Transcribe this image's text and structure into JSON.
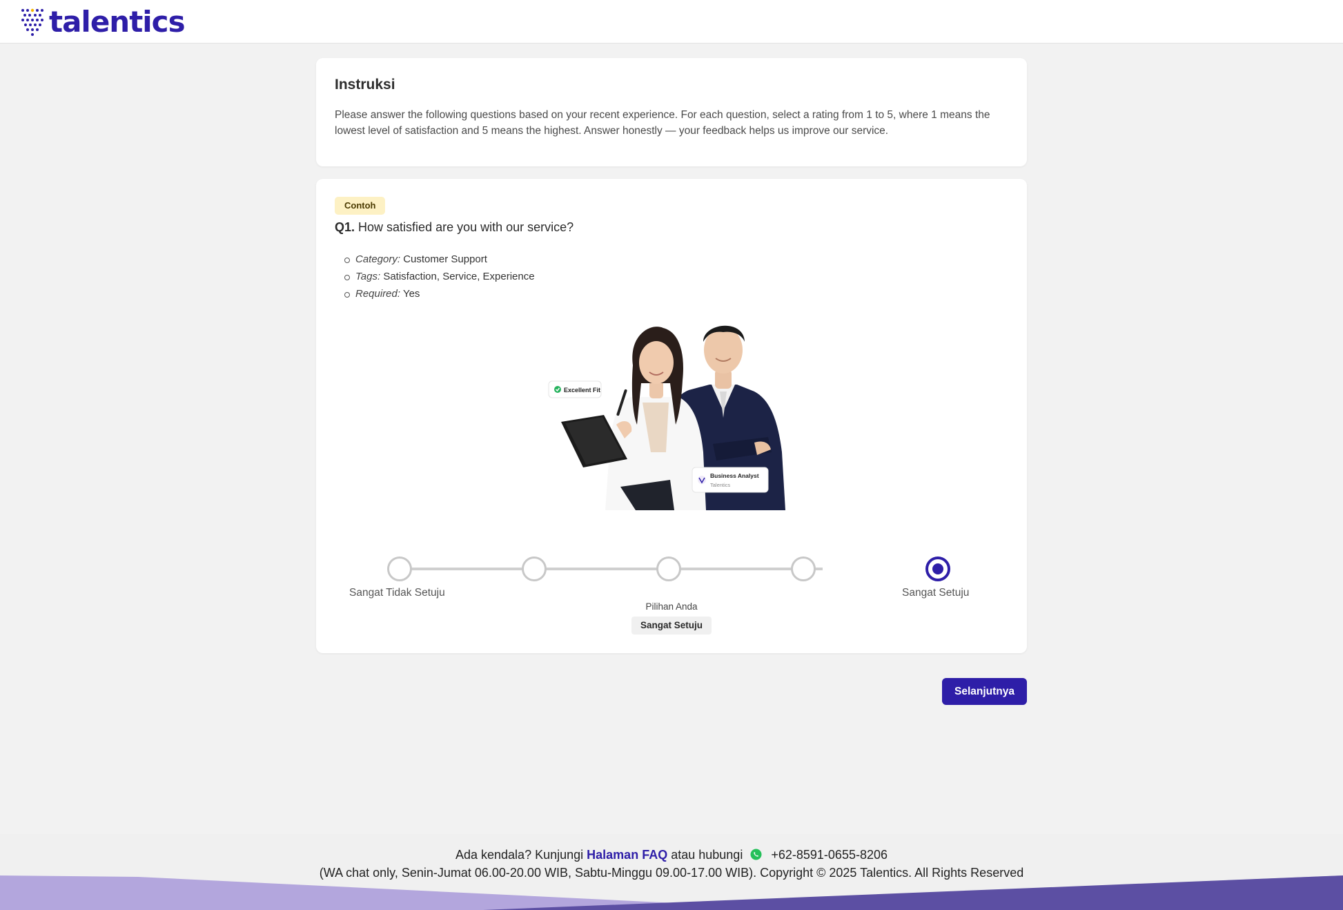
{
  "header": {
    "logo_text": "talentics"
  },
  "instructions": {
    "title": "Instruksi",
    "text": "Please answer the following questions based on your recent experience. For each question, select a rating from 1 to 5, where 1 means the lowest level of satisfaction and 5 means the highest. Answer honestly — your feedback helps us improve our service."
  },
  "question": {
    "badge": "Contoh",
    "number": "Q1.",
    "text": "How satisfied are you with our service?",
    "meta": [
      {
        "label": "Category:",
        "value": "Customer Support"
      },
      {
        "label": "Tags:",
        "value": "Satisfaction, Service, Experience"
      },
      {
        "label": "Required:",
        "value": "Yes"
      }
    ],
    "illustration": {
      "badge_left": "Excellent Fit",
      "card_title": "Business Analyst",
      "card_subtitle": "Talentics"
    }
  },
  "scale": {
    "min_label": "Sangat Tidak Setuju",
    "max_label": "Sangat Setuju",
    "points": 5,
    "selected_index": 5,
    "choice_caption": "Pilihan Anda",
    "choice_value": "Sangat Setuju",
    "accent_color": "#2e1ea8"
  },
  "actions": {
    "next_label": "Selanjutnya"
  },
  "footer": {
    "prefix": "Ada kendala? Kunjungi",
    "faq_link": "Halaman FAQ",
    "middle": "atau hubungi",
    "phone": "+62-8591-0655-8206",
    "line2": "(WA chat only, Senin-Jumat 06.00-20.00 WIB, Sabtu-Minggu 09.00-17.00 WIB). Copyright © 2025 Talentics. All Rights Reserved"
  }
}
